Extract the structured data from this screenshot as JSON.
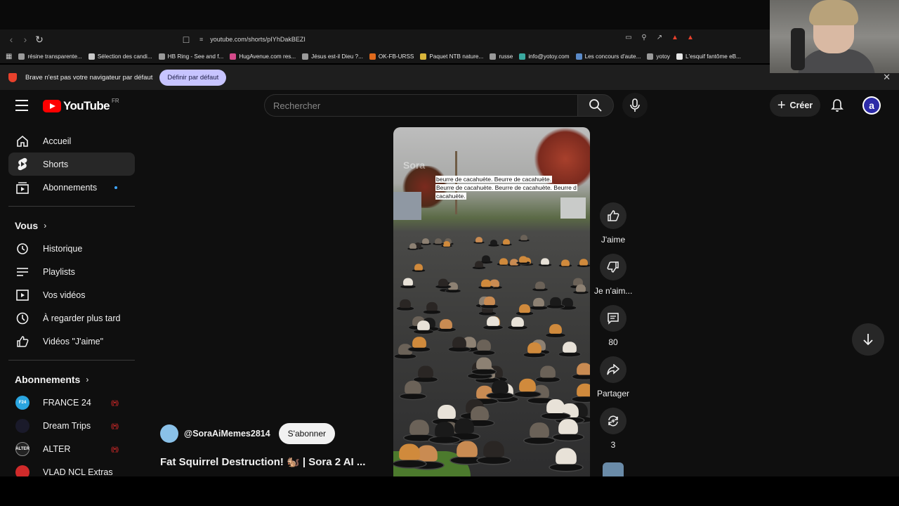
{
  "browser": {
    "url": "youtube.com/shorts/pIYhDakBEZI",
    "bookmarks": [
      {
        "label": "résine transparente...",
        "color": "#9a9a9a"
      },
      {
        "label": "Sélection des candi...",
        "color": "#c8c8c8"
      },
      {
        "label": "HB Ring - See and f...",
        "color": "#9a9a9a"
      },
      {
        "label": "HugAvenue.com res...",
        "color": "#d44a8a"
      },
      {
        "label": "Jésus est-il Dieu ?...",
        "color": "#9a9a9a"
      },
      {
        "label": "OK-FB-URSS",
        "color": "#e06a1c"
      },
      {
        "label": "Paquet NTB nature...",
        "color": "#d9b53a"
      },
      {
        "label": "russe",
        "color": "#9a9a9a"
      },
      {
        "label": "info@yotoy.com",
        "color": "#3aa9a0"
      },
      {
        "label": "Les concours d'aute...",
        "color": "#5a8ac8"
      },
      {
        "label": "yotoy",
        "color": "#9a9a9a"
      },
      {
        "label": "L'esquif fantôme eB...",
        "color": "#e8e8e8"
      }
    ],
    "infobar": {
      "text": "Brave n'est pas votre navigateur par défaut",
      "button": "Définir par défaut"
    }
  },
  "header": {
    "logo_text": "YouTube",
    "country": "FR",
    "search_placeholder": "Rechercher",
    "create_label": "Créer",
    "avatar_letter": "a"
  },
  "sidebar": {
    "main": [
      {
        "label": "Accueil",
        "icon": "home-icon"
      },
      {
        "label": "Shorts",
        "icon": "shorts-icon"
      },
      {
        "label": "Abonnements",
        "icon": "subscriptions-icon"
      }
    ],
    "you_heading": "Vous",
    "you_items": [
      {
        "label": "Historique",
        "icon": "history-icon"
      },
      {
        "label": "Playlists",
        "icon": "playlist-icon"
      },
      {
        "label": "Vos vidéos",
        "icon": "video-icon"
      },
      {
        "label": "À regarder plus tard",
        "icon": "clock-icon"
      },
      {
        "label": "Vidéos \"J'aime\"",
        "icon": "like-icon"
      }
    ],
    "subs_heading": "Abonnements",
    "channels": [
      {
        "label": "FRANCE 24",
        "color": "#2aa5e0",
        "live": true
      },
      {
        "label": "Dream Trips",
        "color": "#1a1a2a",
        "live": true
      },
      {
        "label": "ALTER",
        "color": "#222222",
        "live": true
      },
      {
        "label": "VLAD NCL Extras",
        "color": "#d02a2a",
        "live": false
      }
    ]
  },
  "short": {
    "subtitle_lines": [
      "beurre de cacahuète.  Beurre de cacahuète.",
      "Beurre de cacahuète.  Beurre de cacahuète.  Beurre d",
      "cacahuète."
    ],
    "watermark": "Sora",
    "channel": "@SoraAiMemes2814",
    "subscribe_label": "S'abonner",
    "title": "Fat Squirrel Destruction! 🐿️ | Sora 2 AI ...",
    "actions": {
      "like_label": "J'aime",
      "dislike_label": "Je n'aim...",
      "comments_count": "80",
      "share_label": "Partager",
      "remix_count": "3"
    }
  }
}
